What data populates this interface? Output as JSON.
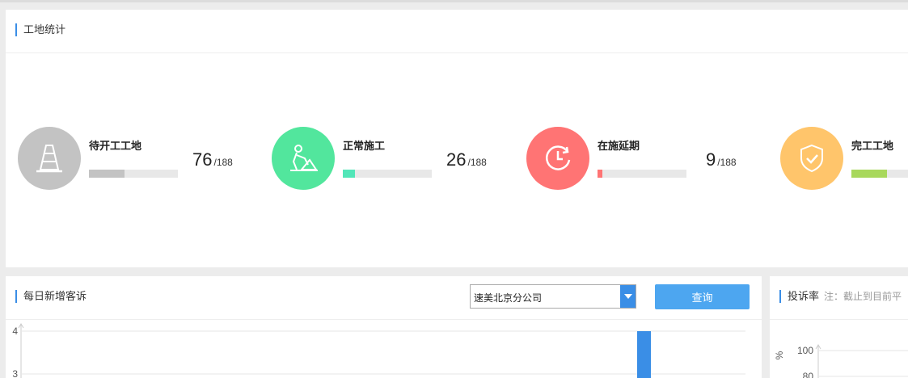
{
  "stats_panel": {
    "title": "工地统计",
    "items": [
      {
        "label": "待开工工地",
        "value": "76",
        "total": "/188",
        "fraction": 0.4,
        "color": "#c3c3c3",
        "bar_color": "#c3c3c3",
        "icon": "traffic-cone-icon"
      },
      {
        "label": "正常施工",
        "value": "26",
        "total": "/188",
        "fraction": 0.14,
        "color": "#52e69d",
        "bar_color": "#52e6b8",
        "icon": "worker-digging-icon"
      },
      {
        "label": "在施延期",
        "value": "9",
        "total": "/188",
        "fraction": 0.05,
        "color": "#ff7474",
        "bar_color": "#ff7474",
        "icon": "clock-delay-icon"
      },
      {
        "label": "完工工地",
        "value": "",
        "total": "",
        "fraction": 0.4,
        "color": "#ffc56b",
        "bar_color": "#a8d85c",
        "icon": "shield-check-icon"
      }
    ]
  },
  "daily_panel": {
    "title": "每日新增客诉",
    "company_select": "速美北京分公司",
    "query_button": "查询"
  },
  "rate_panel": {
    "title": "投诉率",
    "note": "注：截止到目前平"
  },
  "chart_data": [
    {
      "type": "bar",
      "y_tick_labels": [
        "4",
        "3"
      ],
      "ylim": [
        3,
        4
      ],
      "values": [
        4
      ],
      "grid": true,
      "bar_color": "#3a8ee6"
    },
    {
      "type": "line",
      "ylabel": "%",
      "y_tick_labels": [
        "100",
        "80"
      ],
      "ylim": [
        80,
        100
      ],
      "grid": true
    }
  ]
}
